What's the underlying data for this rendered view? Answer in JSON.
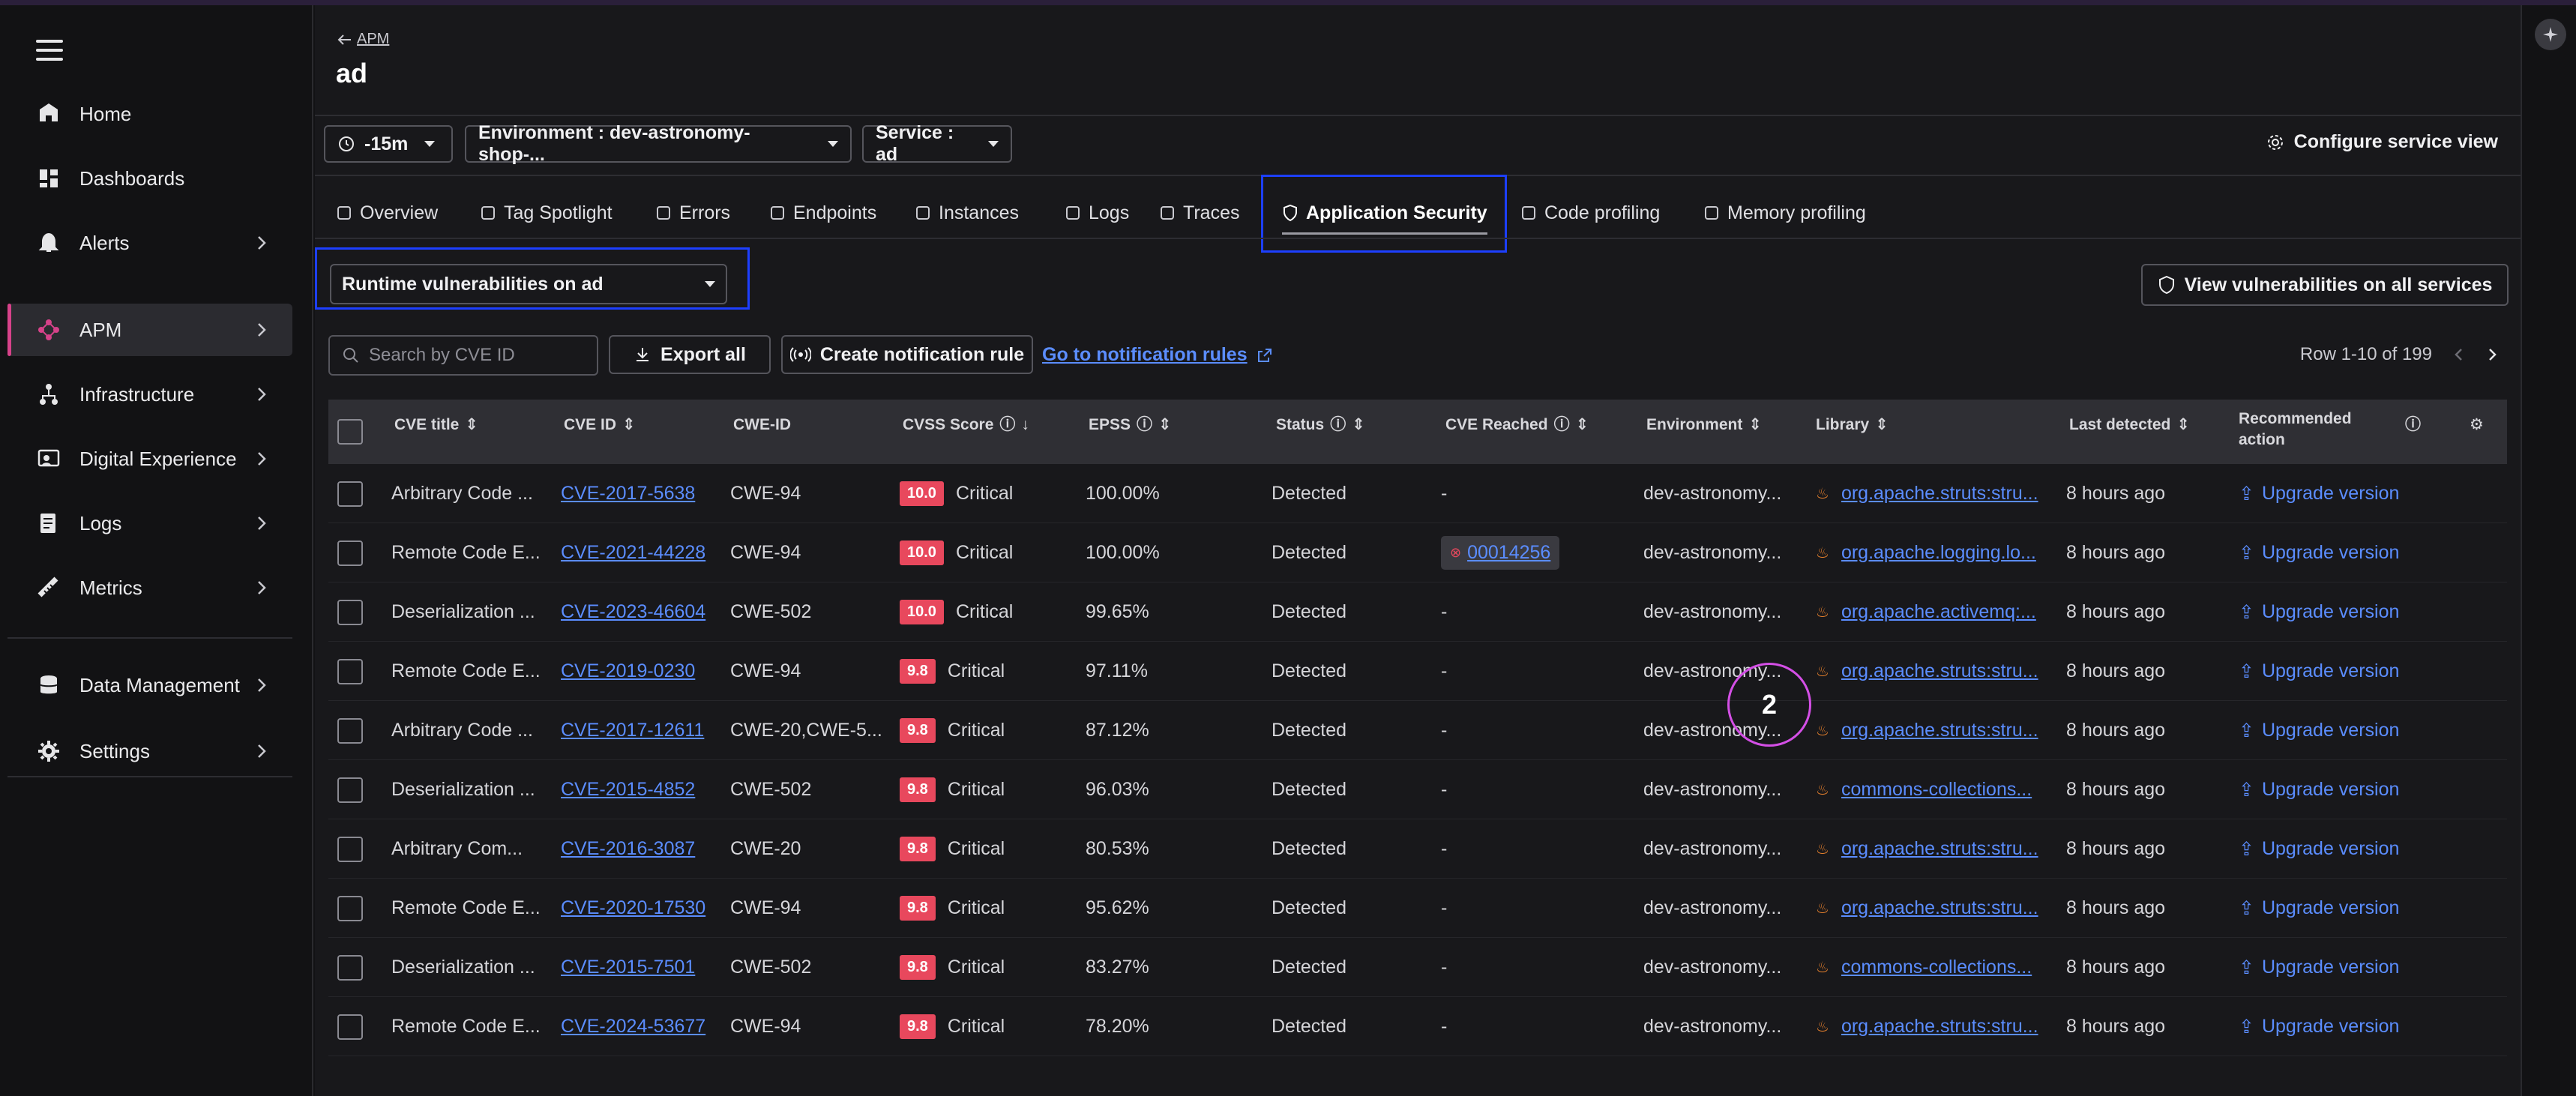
{
  "sidebar": {
    "items": [
      {
        "label": "Home",
        "icon": "home-icon",
        "chevron": false
      },
      {
        "label": "Dashboards",
        "icon": "dashboards-icon",
        "chevron": false
      },
      {
        "label": "Alerts",
        "icon": "bell-icon",
        "chevron": true
      },
      {
        "label": "APM",
        "icon": "apm-icon",
        "chevron": true,
        "active": true
      },
      {
        "label": "Infrastructure",
        "icon": "infrastructure-icon",
        "chevron": true
      },
      {
        "label": "Digital Experience",
        "icon": "digital-experience-icon",
        "chevron": true
      },
      {
        "label": "Logs",
        "icon": "logs-icon",
        "chevron": true
      },
      {
        "label": "Metrics",
        "icon": "metrics-icon",
        "chevron": true
      },
      {
        "label": "Data Management",
        "icon": "database-icon",
        "chevron": true
      },
      {
        "label": "Settings",
        "icon": "gear-icon",
        "chevron": true
      }
    ]
  },
  "header": {
    "back_label": "APM",
    "title": "ad"
  },
  "filters": {
    "time": "-15m",
    "environment": "Environment : dev-astronomy-shop-...",
    "service": "Service : ad",
    "configure_label": "Configure service view"
  },
  "tabs": [
    {
      "label": "Overview",
      "icon": "grid-icon"
    },
    {
      "label": "Tag Spotlight",
      "icon": "tag-icon"
    },
    {
      "label": "Errors",
      "icon": "error-icon"
    },
    {
      "label": "Endpoints",
      "icon": "endpoints-icon"
    },
    {
      "label": "Instances",
      "icon": "layers-icon"
    },
    {
      "label": "Logs",
      "icon": "logs-icon"
    },
    {
      "label": "Traces",
      "icon": "traces-icon"
    },
    {
      "label": "Application Security",
      "icon": "shield-icon",
      "active": true
    },
    {
      "label": "Code profiling",
      "icon": "code-profiling-icon"
    },
    {
      "label": "Memory profiling",
      "icon": "chart-icon"
    }
  ],
  "security": {
    "view_select": "Runtime vulnerabilities on ad",
    "view_all_label": "View vulnerabilities on all services",
    "search_placeholder": "Search by CVE ID",
    "export_label": "Export all",
    "notification_label": "Create notification rule",
    "goto_label": "Go to notification rules",
    "pager_text": "Row 1-10 of 199"
  },
  "table": {
    "headers": {
      "cve_title": "CVE title",
      "cve_id": "CVE ID",
      "cwe_id": "CWE-ID",
      "cvss": "CVSS Score",
      "epss": "EPSS",
      "status": "Status",
      "reached": "CVE Reached",
      "environment": "Environment",
      "library": "Library",
      "last_detected": "Last detected",
      "recommended_1": "Recommended",
      "recommended_2": "action"
    },
    "rows": [
      {
        "title": "Arbitrary Code ...",
        "cve": "CVE-2017-5638",
        "cwe": "CWE-94",
        "score": "10.0",
        "severity": "Critical",
        "epss": "100.00%",
        "status": "Detected",
        "reached": "-",
        "env": "dev-astronomy...",
        "lib": "org.apache.struts:stru...",
        "last": "8 hours ago",
        "action": "Upgrade version"
      },
      {
        "title": "Remote Code E...",
        "cve": "CVE-2021-44228",
        "cwe": "CWE-94",
        "score": "10.0",
        "severity": "Critical",
        "epss": "100.00%",
        "status": "Detected",
        "reached": "00014256",
        "env": "dev-astronomy...",
        "lib": "org.apache.logging.lo...",
        "last": "8 hours ago",
        "action": "Upgrade version"
      },
      {
        "title": "Deserialization ...",
        "cve": "CVE-2023-46604",
        "cwe": "CWE-502",
        "score": "10.0",
        "severity": "Critical",
        "epss": "99.65%",
        "status": "Detected",
        "reached": "-",
        "env": "dev-astronomy...",
        "lib": "org.apache.activemq:...",
        "last": "8 hours ago",
        "action": "Upgrade version"
      },
      {
        "title": "Remote Code E...",
        "cve": "CVE-2019-0230",
        "cwe": "CWE-94",
        "score": "9.8",
        "severity": "Critical",
        "epss": "97.11%",
        "status": "Detected",
        "reached": "-",
        "env": "dev-astronomy...",
        "lib": "org.apache.struts:stru...",
        "last": "8 hours ago",
        "action": "Upgrade version"
      },
      {
        "title": "Arbitrary Code ...",
        "cve": "CVE-2017-12611",
        "cwe": "CWE-20,CWE-5...",
        "score": "9.8",
        "severity": "Critical",
        "epss": "87.12%",
        "status": "Detected",
        "reached": "-",
        "env": "dev-astronomy...",
        "lib": "org.apache.struts:stru...",
        "last": "8 hours ago",
        "action": "Upgrade version"
      },
      {
        "title": "Deserialization ...",
        "cve": "CVE-2015-4852",
        "cwe": "CWE-502",
        "score": "9.8",
        "severity": "Critical",
        "epss": "96.03%",
        "status": "Detected",
        "reached": "-",
        "env": "dev-astronomy...",
        "lib": "commons-collections...",
        "last": "8 hours ago",
        "action": "Upgrade version"
      },
      {
        "title": "Arbitrary Com...",
        "cve": "CVE-2016-3087",
        "cwe": "CWE-20",
        "score": "9.8",
        "severity": "Critical",
        "epss": "80.53%",
        "status": "Detected",
        "reached": "-",
        "env": "dev-astronomy...",
        "lib": "org.apache.struts:stru...",
        "last": "8 hours ago",
        "action": "Upgrade version"
      },
      {
        "title": "Remote Code E...",
        "cve": "CVE-2020-17530",
        "cwe": "CWE-94",
        "score": "9.8",
        "severity": "Critical",
        "epss": "95.62%",
        "status": "Detected",
        "reached": "-",
        "env": "dev-astronomy...",
        "lib": "org.apache.struts:stru...",
        "last": "8 hours ago",
        "action": "Upgrade version"
      },
      {
        "title": "Deserialization ...",
        "cve": "CVE-2015-7501",
        "cwe": "CWE-502",
        "score": "9.8",
        "severity": "Critical",
        "epss": "83.27%",
        "status": "Detected",
        "reached": "-",
        "env": "dev-astronomy...",
        "lib": "commons-collections...",
        "last": "8 hours ago",
        "action": "Upgrade version"
      },
      {
        "title": "Remote Code E...",
        "cve": "CVE-2024-53677",
        "cwe": "CWE-94",
        "score": "9.8",
        "severity": "Critical",
        "epss": "78.20%",
        "status": "Detected",
        "reached": "-",
        "env": "dev-astronomy...",
        "lib": "org.apache.struts:stru...",
        "last": "8 hours ago",
        "action": "Upgrade version"
      }
    ]
  },
  "annotation": {
    "marker": "2"
  },
  "colors": {
    "accent_link": "#5b8dff",
    "critical": "#e8485d",
    "highlight_box": "#1d3fff",
    "apm_active": "#d7428a",
    "annotation_ring": "#d44fe6"
  }
}
